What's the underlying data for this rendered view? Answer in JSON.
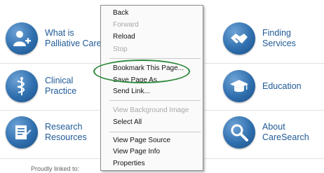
{
  "tiles": {
    "palliative": {
      "label": "What is\nPalliative Care"
    },
    "finding": {
      "label": "Finding\nServices"
    },
    "clinical": {
      "label": "Clinical\nPractice"
    },
    "education": {
      "label": "Education"
    },
    "research": {
      "label": "Research\nResources"
    },
    "about": {
      "label": "About\nCareSearch"
    }
  },
  "footer": {
    "text": "Proudly linked to:"
  },
  "menu": {
    "items": [
      {
        "label": "Back",
        "enabled": true
      },
      {
        "label": "Forward",
        "enabled": false
      },
      {
        "label": "Reload",
        "enabled": true
      },
      {
        "label": "Stop",
        "enabled": false
      },
      {
        "label": "Bookmark This Page...",
        "enabled": true
      },
      {
        "label": "Save Page As...",
        "enabled": true
      },
      {
        "label": "Send Link...",
        "enabled": true
      },
      {
        "label": "View Background Image",
        "enabled": false
      },
      {
        "label": "Select All",
        "enabled": true
      },
      {
        "label": "View Page Source",
        "enabled": true
      },
      {
        "label": "View Page Info",
        "enabled": true
      },
      {
        "label": "Properties",
        "enabled": true
      }
    ]
  },
  "colors": {
    "accent": "#1f5a96",
    "highlight_ring": "#2f8a3e"
  },
  "icons": [
    "person-plus-icon",
    "handshake-icon",
    "caduceus-icon",
    "graduation-cap-icon",
    "document-icon",
    "magnifier-icon"
  ]
}
